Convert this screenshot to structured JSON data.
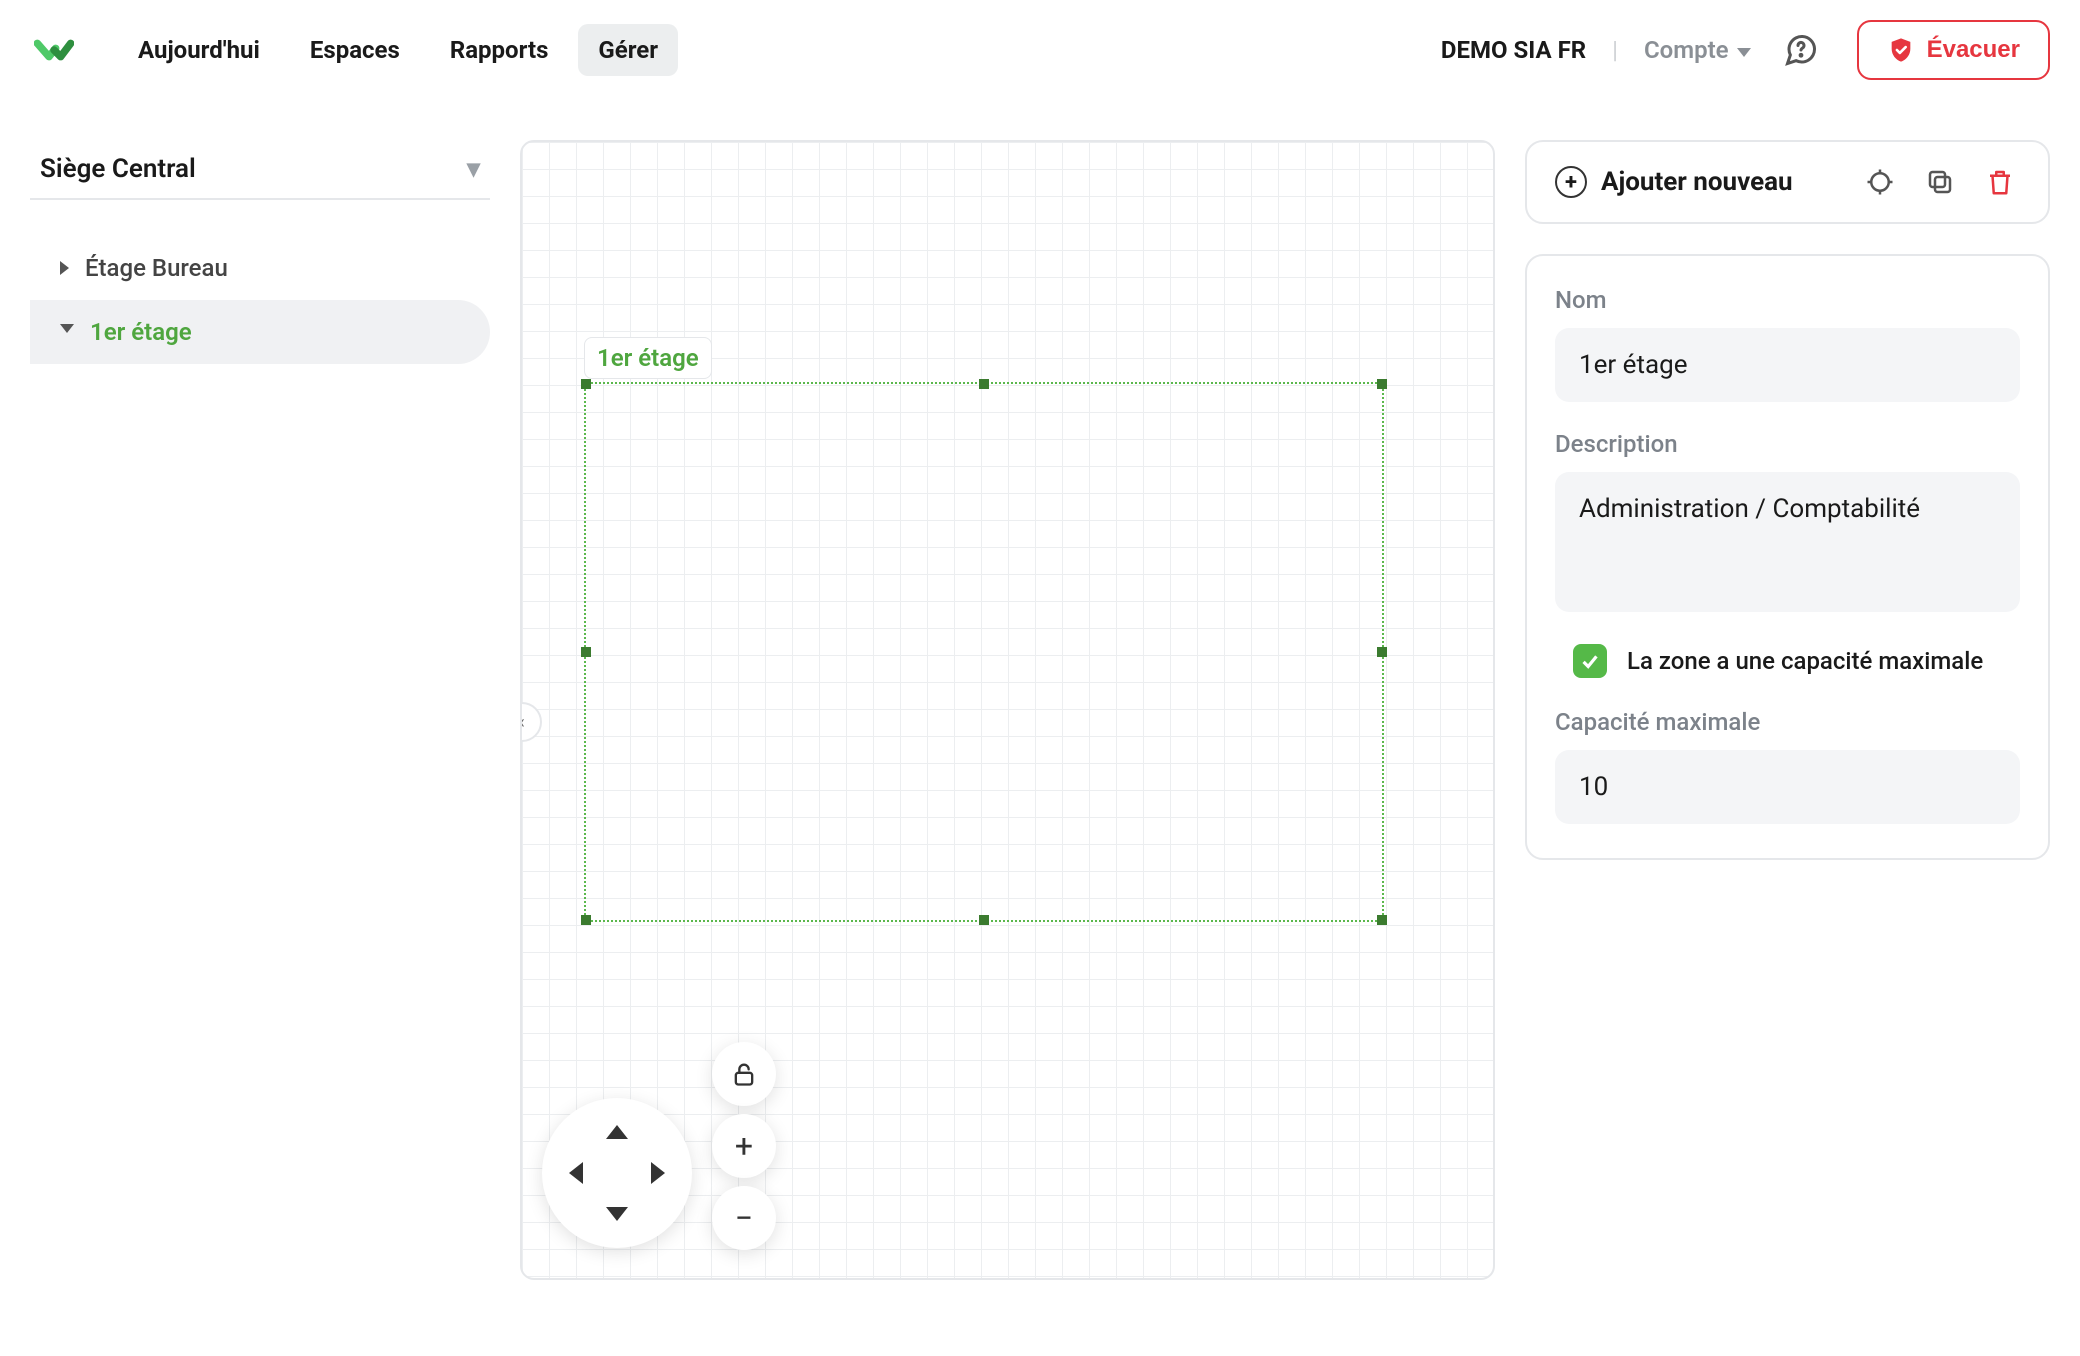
{
  "nav": {
    "links": [
      "Aujourd'hui",
      "Espaces",
      "Rapports",
      "Gérer"
    ],
    "active_index": 3,
    "org": "DEMO SIA FR",
    "account_label": "Compte",
    "evacuate_label": "Évacuer"
  },
  "sidebar": {
    "site": "Siège Central",
    "items": [
      {
        "label": "Étage Bureau",
        "expanded": false,
        "selected": false
      },
      {
        "label": "1er étage",
        "expanded": true,
        "selected": true
      }
    ]
  },
  "canvas": {
    "zone_label": "1er étage"
  },
  "toolbar": {
    "add_label": "Ajouter nouveau"
  },
  "form": {
    "name_label": "Nom",
    "name_value": "1er étage",
    "description_label": "Description",
    "description_value": "Administration / Comptabilité",
    "has_capacity_label": "La zone a une capacité maximale",
    "has_capacity_checked": true,
    "capacity_label": "Capacité maximale",
    "capacity_value": "10"
  }
}
